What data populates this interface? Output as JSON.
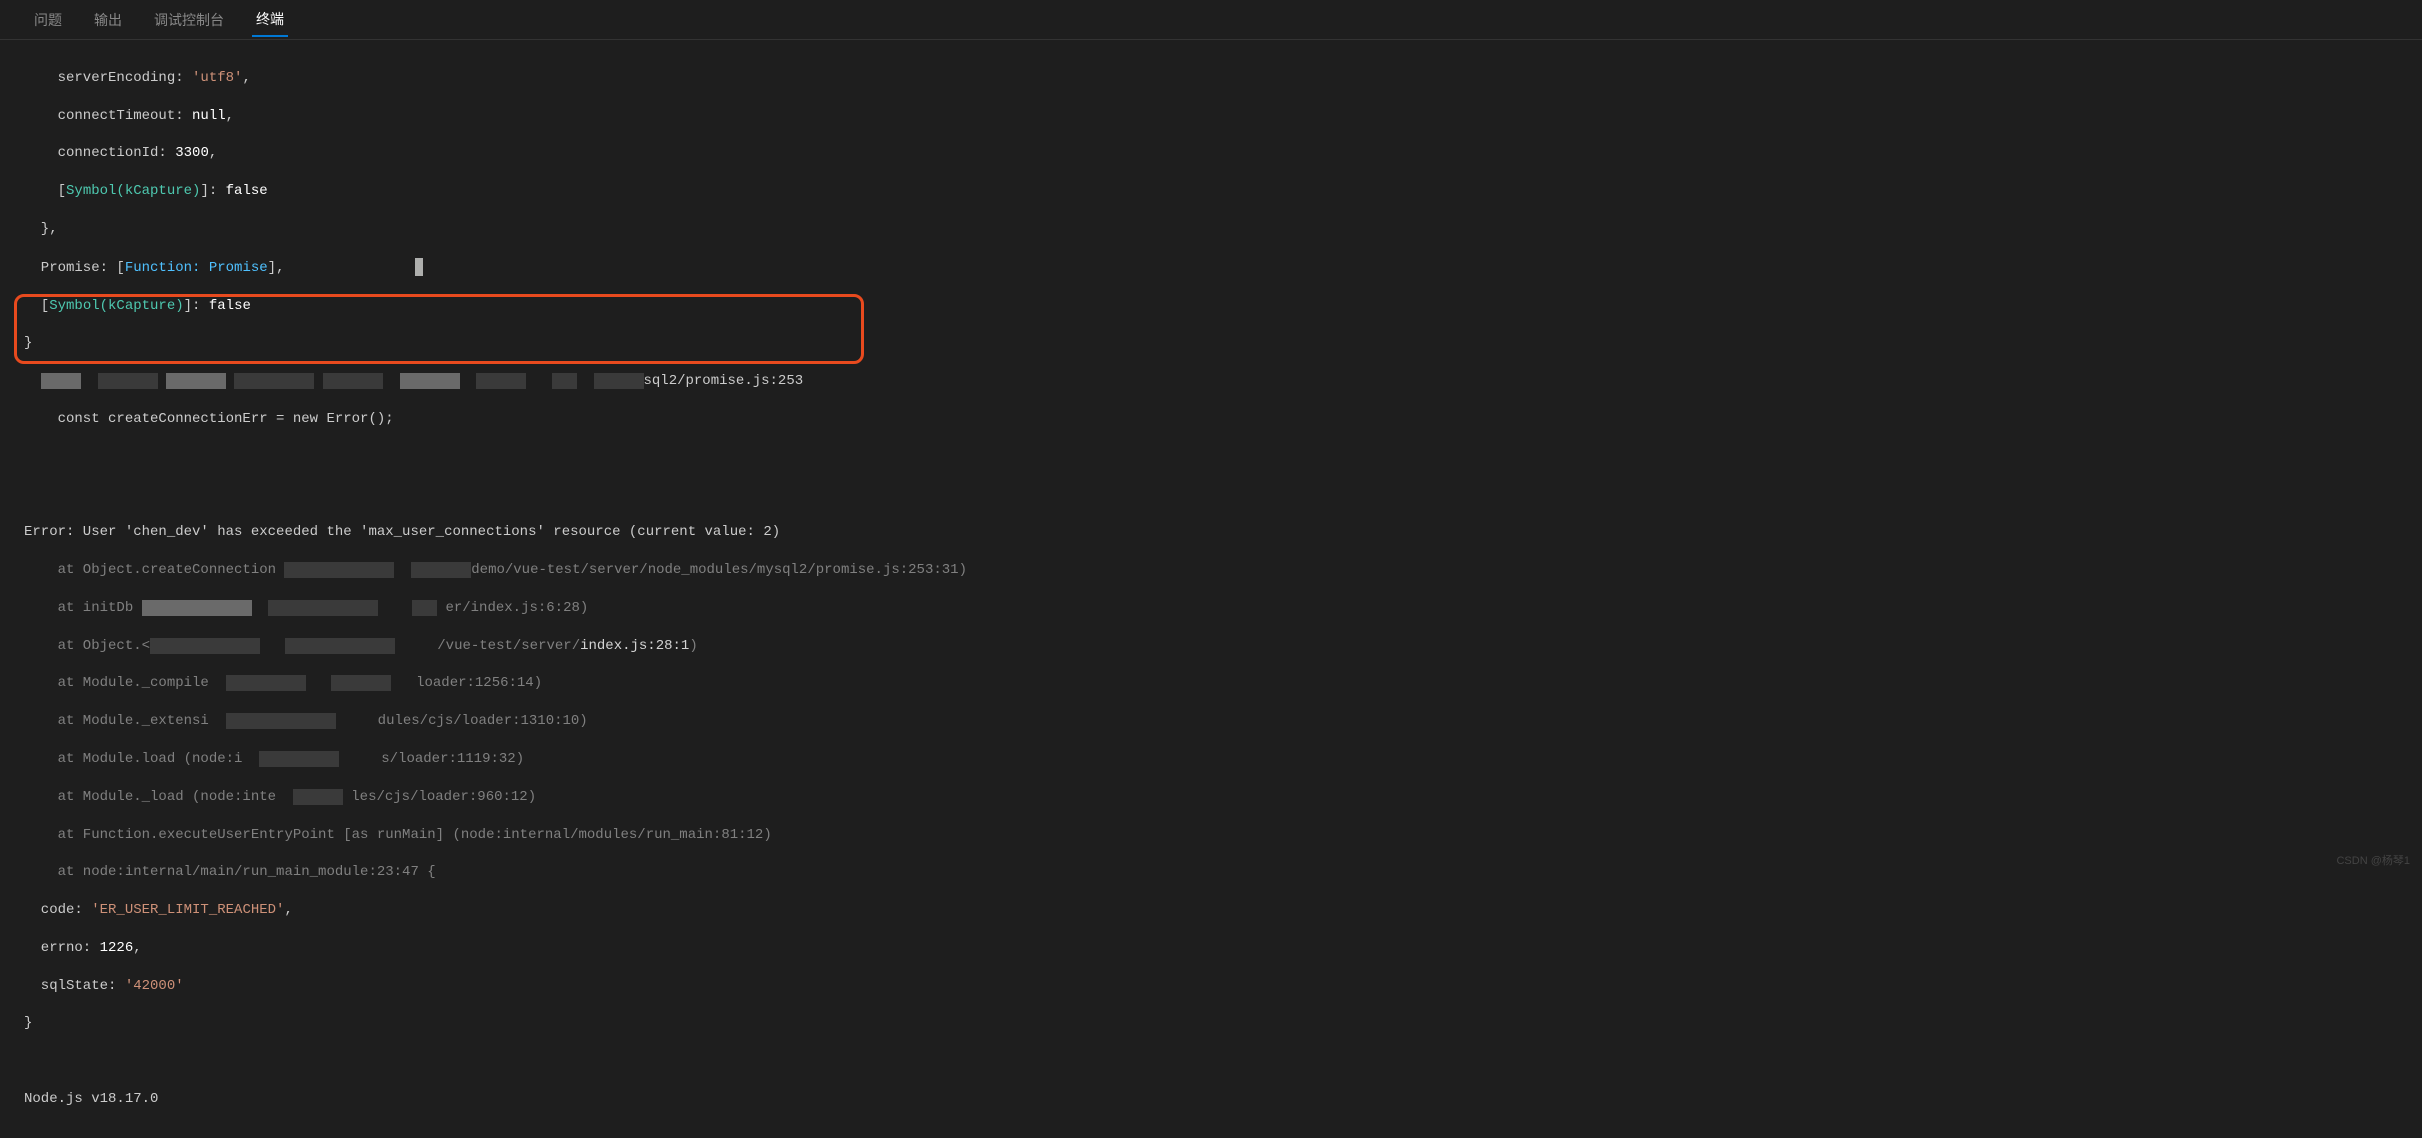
{
  "tabs": {
    "problems": "问题",
    "output": "输出",
    "debug_console": "调试控制台",
    "terminal": "终端"
  },
  "output": {
    "l_serverEncoding_key": "    serverEncoding: ",
    "l_serverEncoding_val": "'utf8'",
    "l_serverEncoding_comma": ",",
    "l_connectTimeout_key": "    connectTimeout: ",
    "l_connectTimeout_val": "null",
    "l_connectTimeout_comma": ",",
    "l_connectionId_key": "    connectionId: ",
    "l_connectionId_val": "3300",
    "l_connectionId_comma": ",",
    "l_kCapture1_open": "    [",
    "l_kCapture1_sym": "Symbol(kCapture)",
    "l_kCapture1_mid": "]: ",
    "l_kCapture1_val": "false",
    "l_close1": "  },",
    "l_promise_key": "  Promise: ",
    "l_promise_open": "[",
    "l_promise_func": "Function: Promise",
    "l_promise_close": "]",
    "l_promise_comma": ",",
    "l_kCapture2_open": "  [",
    "l_kCapture2_sym": "Symbol(kCapture)",
    "l_kCapture2_mid": "]: ",
    "l_kCapture2_val": "false",
    "l_close2": "}",
    "l_path_suffix": "sql2/promise.js:253",
    "l_const_err": "    const createConnectionErr = new Error();",
    "l_blank": " ",
    "l_error_main": "Error: User 'chen_dev' has exceeded the 'max_user_connections' resource (current value: 2)",
    "l_at1_a": "    at Object.createConnection ",
    "l_at1_b": "demo/vue-test/server/",
    "l_at1_c": "node_modules/mysql2",
    "l_at1_d": "/promise.js:253:31)",
    "l_at2_a": "    at initDb ",
    "l_at2_b": "er/index.js:6:28)",
    "l_at3_a": "    at Object.<",
    "l_at3_b": "/vue-test/server/",
    "l_at3_c": "index.js:28:1",
    "l_at3_d": ")",
    "l_at4_a": "    at Module._compile",
    "l_at4_b": "loader:1256:14)",
    "l_at5_a": "    at Module._extensi",
    "l_at5_b": "dules/cjs/loader:1310:10)",
    "l_at6_a": "    at Module.load (node:i",
    "l_at6_b": "s/loader:1119:32)",
    "l_at7_a": "    at Module._load (node:inte",
    "l_at7_b": "les/cjs/loader:960:12)",
    "l_at8": "    at Function.executeUserEntryPoint [as runMain] (node:internal/modules/run_main:81:12)",
    "l_at9": "    at node:internal/main/run_main_module:23:47 {",
    "l_code_key": "  code: ",
    "l_code_val": "'ER_USER_LIMIT_REACHED'",
    "l_code_comma": ",",
    "l_errno_key": "  errno: ",
    "l_errno_val": "1226",
    "l_errno_comma": ",",
    "l_sqlState_key": "  sqlState: ",
    "l_sqlState_val": "'42000'",
    "l_close3": "}",
    "l_node_ver": "Node.js v18.17.0"
  },
  "watermark": "CSDN @杨琴1"
}
